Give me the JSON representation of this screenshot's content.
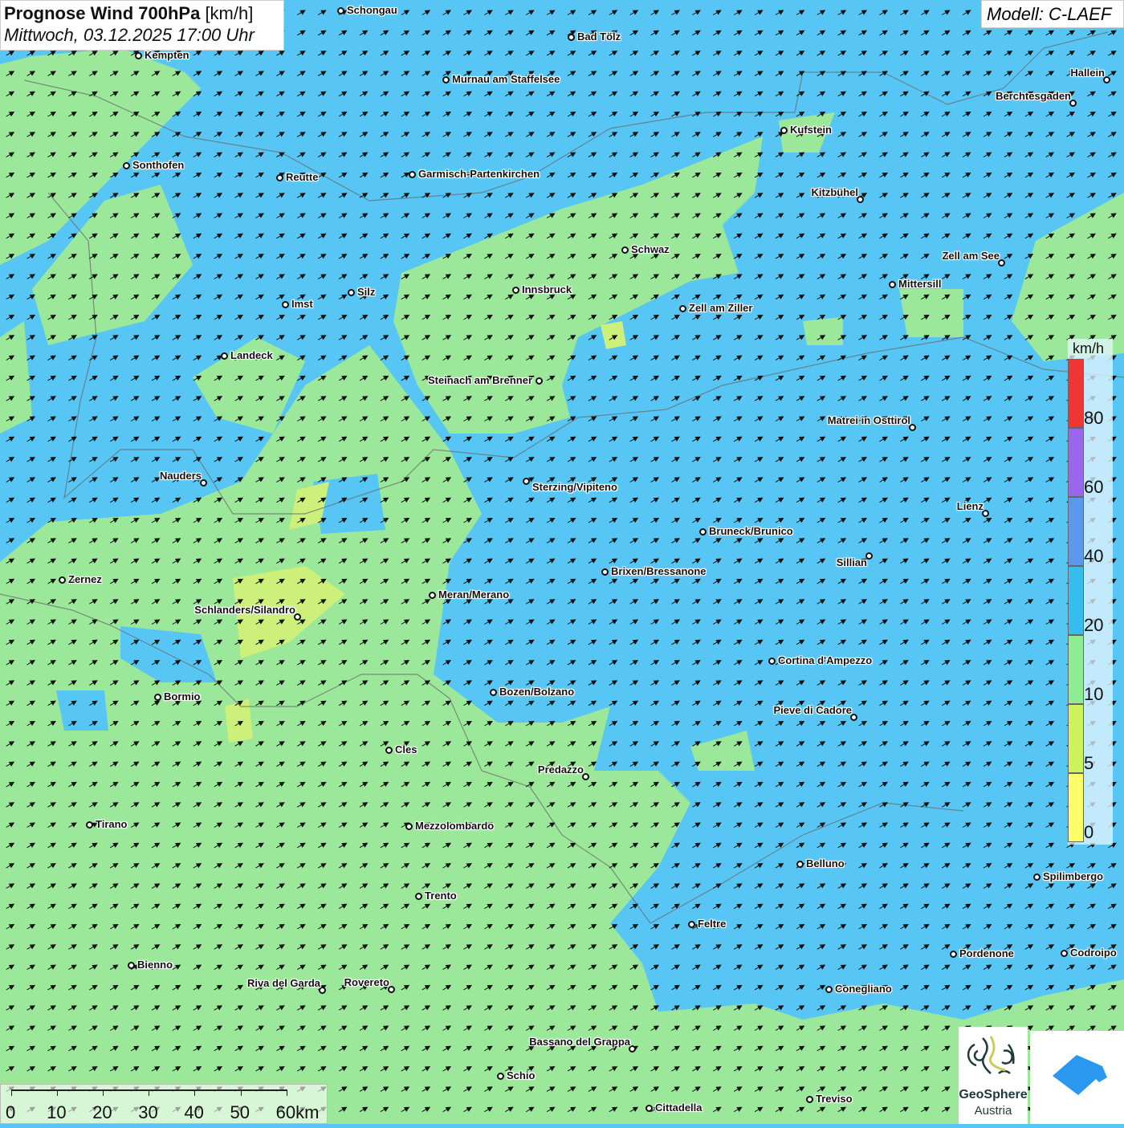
{
  "header": {
    "title_bold": "Prognose Wind 700hPa",
    "title_unit": "[km/h]",
    "subtitle": "Mittwoch, 03.12.2025 17:00 Uhr"
  },
  "model": {
    "label": "Modell: C-LAEF"
  },
  "legend": {
    "unit": "km/h",
    "ticks": [
      "80",
      "60",
      "40",
      "20",
      "10",
      "5",
      "0"
    ],
    "colors": [
      "#f03535",
      "#9b66ee",
      "#5b98ee",
      "#35bdf0",
      "#8fec92",
      "#cdf25a",
      "#fdfd6a"
    ]
  },
  "scale": {
    "labels": [
      "0",
      "10",
      "20",
      "30",
      "40",
      "50",
      "60km"
    ]
  },
  "logos": {
    "geosphere_line1": "GeoSphere",
    "geosphere_line2": "Austria"
  },
  "colors": {
    "calm_green": "#9ce89a",
    "blue": "#58c6f4",
    "yellow": "#cdf07a"
  },
  "cities": [
    "Schongau",
    "Bad Tölz",
    "Kempten",
    "Murnau am Staffelsee",
    "Hallein",
    "Berchtesgaden",
    "Kufstein",
    "Sonthofen",
    "Reutte",
    "Garmisch-Partenkirchen",
    "Kitzbühel",
    "Schwaz",
    "Zell am See",
    "Mittersill",
    "Innsbruck",
    "Silz",
    "Zell am Ziller",
    "Imst",
    "Landeck",
    "Steinach am Brenner",
    "Matrei in Osttirol",
    "Nauders",
    "Sterzing/Vipiteno",
    "Lienz",
    "Bruneck/Brunico",
    "Sillian",
    "Brixen/Bressanone",
    "Zernez",
    "Meran/Merano",
    "Schlanders/Silandro",
    "Cortina d'Ampezzo",
    "Bozen/Bolzano",
    "Bormio",
    "Pieve di Cadore",
    "Cles",
    "Predazzo",
    "Tirano",
    "Mezzolombardo",
    "Belluno",
    "Spilimbergo",
    "Trento",
    "Feltre",
    "Pordenone",
    "Codroipo",
    "Bienno",
    "Riva del Garda",
    "Rovereto",
    "Conegliano",
    "Bassano del Grappa",
    "Schio",
    "Treviso",
    "Cittadella"
  ]
}
